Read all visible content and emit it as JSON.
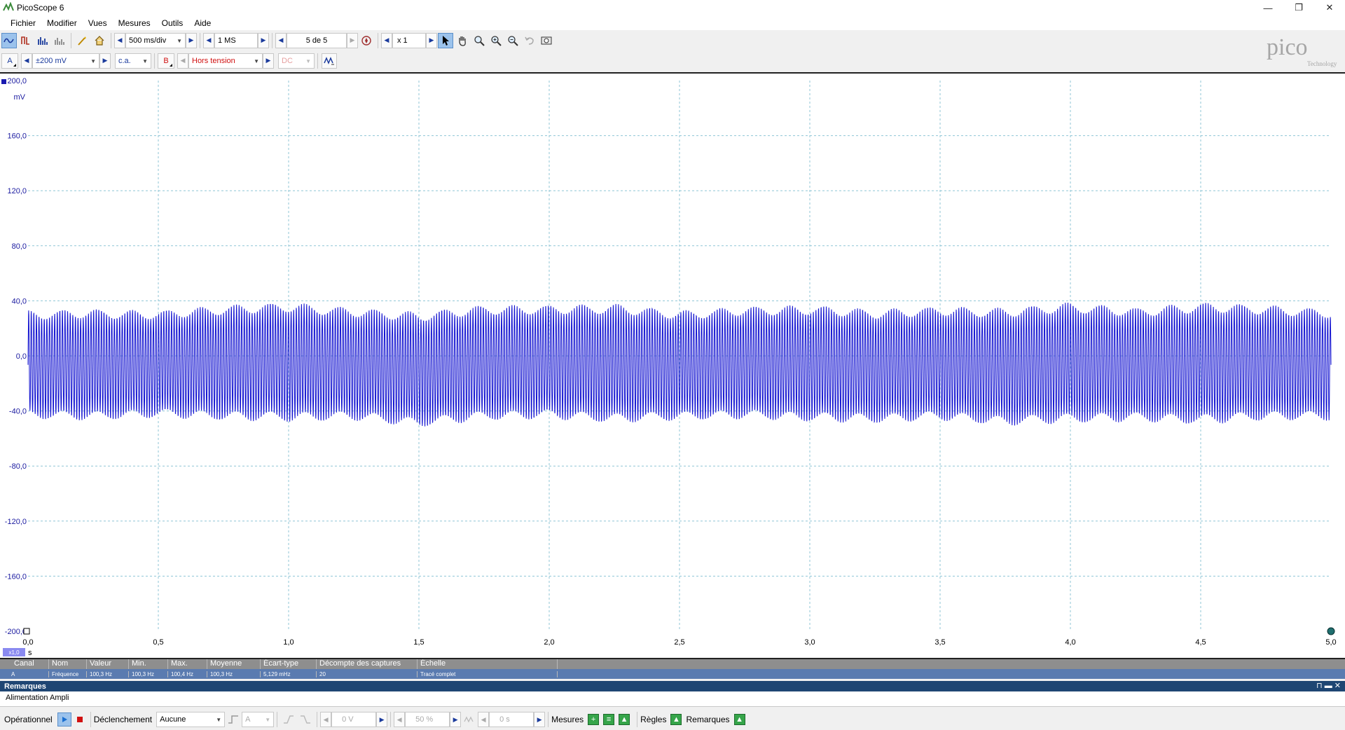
{
  "window": {
    "title": "PicoScope 6",
    "minimize": "—",
    "maximize": "❐",
    "close": "✕"
  },
  "menu": [
    "Fichier",
    "Modifier",
    "Vues",
    "Mesures",
    "Outils",
    "Aide"
  ],
  "toolbar": {
    "timebase": "500 ms/div",
    "samples": "1 MS",
    "capture": "5 de 5",
    "zoom": "x 1"
  },
  "channels": {
    "a_label": "A",
    "a_range": "±200 mV",
    "a_coupling": "c.a.",
    "b_label": "B",
    "b_range": "Hors tension",
    "b_coupling": "DC"
  },
  "logo": {
    "name": "pico",
    "sub": "Technology"
  },
  "chart_data": {
    "type": "line",
    "title": "",
    "xlabel": "s",
    "ylabel": "mV",
    "xlim": [
      0,
      5.0
    ],
    "ylim": [
      -200,
      200
    ],
    "x_ticks": [
      "0,0",
      "0,5",
      "1,0",
      "1,5",
      "2,0",
      "2,5",
      "3,0",
      "3,5",
      "4,0",
      "4,5",
      "5,0"
    ],
    "y_ticks": [
      "200,0",
      "160,0",
      "120,0",
      "80,0",
      "40,0",
      "0,0",
      "-40,0",
      "-80,0",
      "-120,0",
      "-160,0",
      "-200,0"
    ],
    "y_unit": "mV",
    "x_unit": "s",
    "x_zoom": "x1,0",
    "grid": true,
    "series": [
      {
        "channel": "A",
        "color": "#1010d0",
        "envelope_x": [
          0.0,
          0.25,
          0.5,
          0.75,
          1.0,
          1.25,
          1.5,
          1.75,
          2.0,
          2.25,
          2.5,
          2.75,
          3.0,
          3.25,
          3.5,
          3.75,
          4.0,
          4.25,
          4.5,
          4.75,
          5.0
        ],
        "envelope_max": [
          33,
          34,
          33,
          37,
          39,
          35,
          32,
          37,
          37,
          38,
          33,
          36,
          37,
          34,
          36,
          35,
          39,
          35,
          39,
          37,
          34
        ],
        "envelope_min": [
          -46,
          -47,
          -45,
          -47,
          -48,
          -47,
          -52,
          -47,
          -46,
          -49,
          -47,
          -46,
          -48,
          -49,
          -47,
          -51,
          -49,
          -48,
          -50,
          -47,
          -47
        ],
        "frequency_hz": 100.3
      }
    ]
  },
  "measurements": {
    "headers": [
      "Canal",
      "Nom",
      "Valeur",
      "Min.",
      "Max.",
      "Moyenne",
      "Écart-type",
      "Décompte des captures",
      "Échelle"
    ],
    "row": [
      "A",
      "Fréquence",
      "100,3 Hz",
      "100,3 Hz",
      "100,4 Hz",
      "100,3 Hz",
      "5,129 mHz",
      "20",
      "Tracé complet"
    ]
  },
  "notes": {
    "title": "Remarques",
    "controls": "⊓ ▬ ✕",
    "text": "Alimentation Ampli"
  },
  "status": {
    "mode": "Opérationnel",
    "trigger_label": "Déclenchement",
    "trigger_value": "Aucune",
    "trig_channel": "A",
    "trig_level": "0 V",
    "trig_pos": "50 %",
    "trig_delay": "0 s",
    "measures": "Mesures",
    "rulers": "Règles",
    "notes": "Remarques"
  }
}
